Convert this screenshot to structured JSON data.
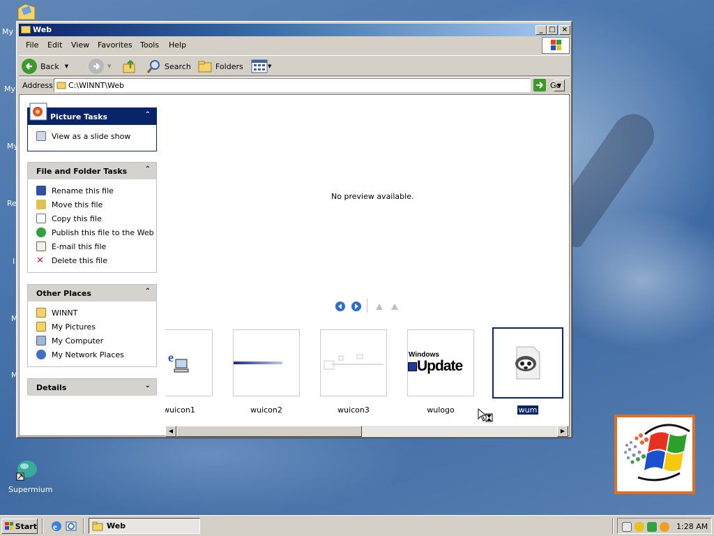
{
  "desktop": {
    "icons": [
      {
        "label": "My"
      },
      {
        "label": "My"
      },
      {
        "label": "My"
      },
      {
        "label": "Re"
      },
      {
        "label": "I"
      },
      {
        "label": "M"
      },
      {
        "label": "M"
      },
      {
        "label": "Supermium"
      }
    ]
  },
  "window": {
    "title": "Web",
    "menu": [
      "File",
      "Edit",
      "View",
      "Favorites",
      "Tools",
      "Help"
    ],
    "toolbar": {
      "back": "Back",
      "search": "Search",
      "folders": "Folders"
    },
    "address": {
      "label": "Address",
      "value": "C:\\WINNT\\Web",
      "go": "Go"
    },
    "panes": {
      "picture_tasks": {
        "title": "Picture Tasks",
        "items": [
          "View as a slide show"
        ]
      },
      "file_tasks": {
        "title": "File and Folder Tasks",
        "items": [
          "Rename this file",
          "Move this file",
          "Copy this file",
          "Publish this file to the Web",
          "E-mail this file",
          "Delete this file"
        ]
      },
      "other_places": {
        "title": "Other Places",
        "items": [
          "WINNT",
          "My Pictures",
          "My Computer",
          "My Network Places"
        ]
      },
      "details": {
        "title": "Details"
      }
    },
    "preview": {
      "message": "No preview available."
    },
    "thumbnails": [
      {
        "label": "wuicon1",
        "selected": false
      },
      {
        "label": "wuicon2",
        "selected": false
      },
      {
        "label": "wuicon3",
        "selected": false
      },
      {
        "label": "wulogo",
        "selected": false,
        "art_line1": "Windows",
        "art_line2": "Update"
      },
      {
        "label": "wum",
        "selected": true
      }
    ]
  },
  "taskbar": {
    "start": "Start",
    "task": "Web",
    "clock": "1:28 AM"
  },
  "colors": {
    "title_start": "#0a246a",
    "title_end": "#a6caf0",
    "selection": "#0a246a"
  }
}
